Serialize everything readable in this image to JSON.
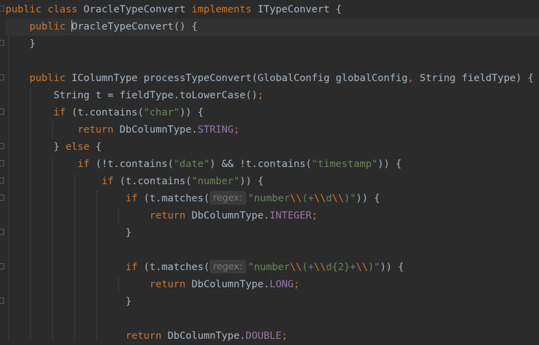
{
  "code": {
    "class_decl": {
      "kw_public": "public",
      "kw_class": "class",
      "class_name": "OracleTypeConvert",
      "kw_implements": "implements",
      "interface_name": "ITypeConvert",
      "brace": "{"
    },
    "ctor": {
      "kw_public": "public",
      "name_first": "O",
      "name_rest": "racleTypeConvert",
      "rest": "() {",
      "close": "}"
    },
    "method": {
      "kw_public": "public",
      "return_type": "IColumnType",
      "name": "processTypeConvert",
      "params_1": "(GlobalConfig globalConfig",
      "comma": ",",
      "params_2": " String fieldType) {"
    },
    "line_string_t": {
      "text": "String t = fieldType.toLowerCase()",
      "semi": ";"
    },
    "if_char": {
      "kw_if": "if",
      "pre": " (t.contains(",
      "str": "\"char\"",
      "post": ")) {"
    },
    "return_string": {
      "kw_return": "return",
      "pre": " DbColumnType.",
      "field": "STRING",
      "semi": ";"
    },
    "else_line": {
      "open": "} ",
      "kw_else": "else",
      "brace": " {"
    },
    "if_date": {
      "kw_if": "if",
      "pre": " (!t.contains(",
      "str1": "\"date\"",
      "mid": ") && !t.contains(",
      "str2": "\"timestamp\"",
      "post": ")) {"
    },
    "if_number": {
      "kw_if": "if",
      "pre": " (t.contains(",
      "str": "\"number\"",
      "post": ")) {"
    },
    "if_matches_1": {
      "kw_if": "if",
      "pre": " (t.matches(",
      "hint": "regex:",
      "str_a": "\"number",
      "esc_a": "\\\\",
      "str_b": "(+",
      "esc_b": "\\\\",
      "str_c": "d",
      "esc_c": "\\\\",
      "str_d": ")\"",
      "post": ")) {"
    },
    "return_integer": {
      "kw_return": "return",
      "pre": " DbColumnType.",
      "field": "INTEGER",
      "semi": ";"
    },
    "close_1": "}",
    "if_matches_2": {
      "kw_if": "if",
      "pre": " (t.matches(",
      "hint": "regex:",
      "str_a": "\"number",
      "esc_a": "\\\\",
      "str_b": "(+",
      "esc_b": "\\\\",
      "str_c": "d{2}+",
      "esc_c": "\\\\",
      "str_d": ")\"",
      "post": ")) {"
    },
    "return_long": {
      "kw_return": "return",
      "pre": " DbColumnType.",
      "field": "LONG",
      "semi": ";"
    },
    "close_2": "}",
    "return_double": {
      "kw_return": "return",
      "pre": " DbColumnType.",
      "field": "DOUBLE",
      "semi": ";"
    }
  },
  "colors": {
    "background": "#2b2b2b",
    "current_line": "#323232",
    "keyword": "#cc7832",
    "string": "#6a8759",
    "field": "#9876aa",
    "default": "#a9b7c6"
  }
}
